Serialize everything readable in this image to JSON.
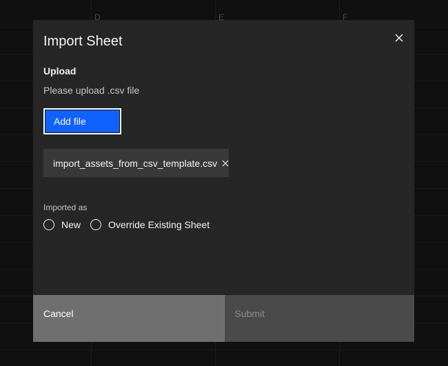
{
  "background_sheet": {
    "column_headers": [
      "D",
      "E",
      "F"
    ]
  },
  "modal": {
    "title": "Import Sheet",
    "close_icon": "close-icon",
    "upload": {
      "heading": "Upload",
      "description": "Please upload .csv file",
      "add_file_label": "Add file"
    },
    "file": {
      "name": "import_assets_from_csv_template.csv",
      "remove_icon": "close-icon"
    },
    "imported_as": {
      "label": "Imported as",
      "options": [
        {
          "label": "New",
          "selected": false
        },
        {
          "label": "Override Existing Sheet",
          "selected": false
        }
      ]
    },
    "footer": {
      "cancel_label": "Cancel",
      "submit_label": "Submit",
      "submit_disabled": true
    }
  },
  "colors": {
    "primary_button": "#0f62fe",
    "modal_background": "#262626",
    "chip_background": "#393939",
    "cancel_background": "#6f6f6f",
    "submit_disabled_background": "#4a4a4a"
  }
}
